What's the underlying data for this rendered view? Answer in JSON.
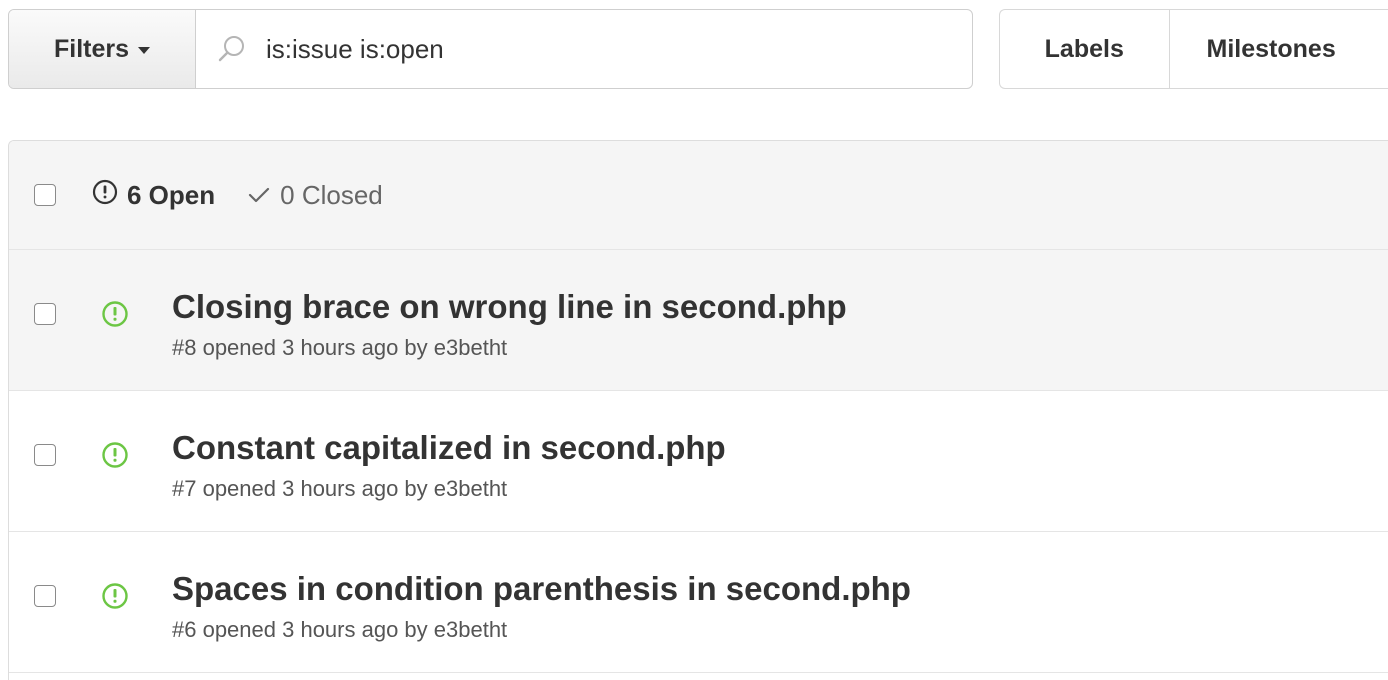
{
  "toolbar": {
    "filters_label": "Filters",
    "search_value": "is:issue is:open",
    "labels_label": "Labels",
    "milestones_label": "Milestones"
  },
  "header": {
    "open_label": "6 Open",
    "closed_label": "0 Closed"
  },
  "issues": [
    {
      "title": "Closing brace on wrong line in second.php",
      "meta": "#8 opened 3 hours ago by e3betht"
    },
    {
      "title": "Constant capitalized in second.php",
      "meta": "#7 opened 3 hours ago by e3betht"
    },
    {
      "title": "Spaces in condition parenthesis in second.php",
      "meta": "#6 opened 3 hours ago by e3betht"
    }
  ],
  "colors": {
    "open_icon_green": "#6cc644",
    "text": "#333333",
    "muted": "#666666",
    "header_bg": "#f5f5f5"
  }
}
